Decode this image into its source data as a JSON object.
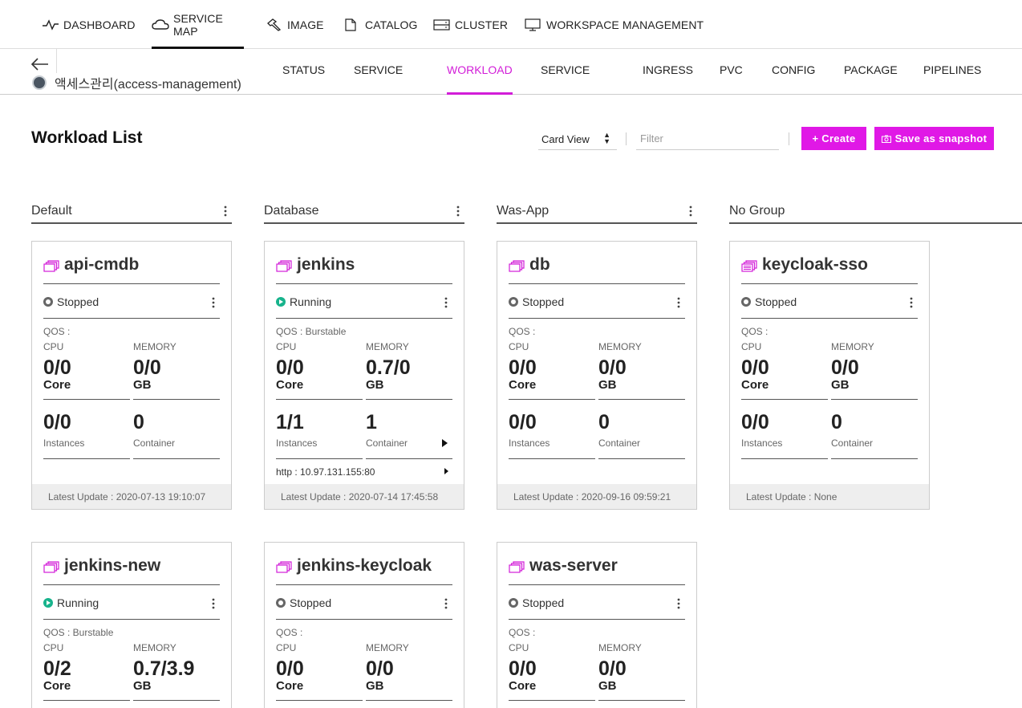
{
  "topnav": {
    "items": [
      {
        "label": "DASHBOARD",
        "icon": "pulse-icon"
      },
      {
        "label": "SERVICE MAP",
        "icon": "cloud-icon",
        "active": true
      },
      {
        "label": "IMAGE",
        "icon": "hammer-icon"
      },
      {
        "label": "CATALOG",
        "icon": "document-icon"
      },
      {
        "label": "CLUSTER",
        "icon": "server-icon"
      },
      {
        "label": "WORKSPACE MANAGEMENT",
        "icon": "monitor-icon"
      }
    ]
  },
  "subnav": {
    "workspace": "액세스관리(access-management)",
    "tabs": [
      {
        "label": "STATUS"
      },
      {
        "label": "SERVICE"
      },
      {
        "label": "WORKLOAD",
        "active": true
      },
      {
        "label": "SERVICE"
      },
      {
        "label": "INGRESS"
      },
      {
        "label": "PVC"
      },
      {
        "label": "CONFIG"
      },
      {
        "label": "PACKAGE"
      },
      {
        "label": "PIPELINES"
      }
    ]
  },
  "toolbar": {
    "title": "Workload List",
    "view": "Card View",
    "filter_placeholder": "Filter",
    "create_label": "+ Create",
    "snapshot_label": "Save as snapshot"
  },
  "groups": [
    {
      "name": "Default"
    },
    {
      "name": "Database"
    },
    {
      "name": "Was-App"
    },
    {
      "name": "No Group"
    }
  ],
  "cards": [
    {
      "name": "api-cmdb",
      "status": "Stopped",
      "qos": "QOS :",
      "cpu_label": "CPU",
      "mem_label": "MEMORY",
      "cpu": "0/0",
      "cpu_unit": "Core",
      "mem": "0/0",
      "mem_unit": "GB",
      "instances": "0/0",
      "instances_label": "Instances",
      "containers": "0",
      "containers_label": "Container",
      "url": "",
      "updated": "Latest Update : 2020-07-13 19:10:07"
    },
    {
      "name": "jenkins",
      "status": "Running",
      "qos": "QOS : Burstable",
      "cpu_label": "CPU",
      "mem_label": "MEMORY",
      "cpu": "0/0",
      "cpu_unit": "Core",
      "mem": "0.7/0",
      "mem_unit": "GB",
      "instances": "1/1",
      "instances_label": "Instances",
      "containers": "1",
      "containers_label": "Container",
      "url": "http : 10.97.131.155:80",
      "updated": "Latest Update : 2020-07-14 17:45:58"
    },
    {
      "name": "db",
      "status": "Stopped",
      "qos": "QOS :",
      "cpu_label": "CPU",
      "mem_label": "MEMORY",
      "cpu": "0/0",
      "cpu_unit": "Core",
      "mem": "0/0",
      "mem_unit": "GB",
      "instances": "0/0",
      "instances_label": "Instances",
      "containers": "0",
      "containers_label": "Container",
      "url": "",
      "updated": "Latest Update : 2020-09-16 09:59:21"
    },
    {
      "name": "keycloak-sso",
      "status": "Stopped",
      "qos": "QOS :",
      "cpu_label": "CPU",
      "mem_label": "MEMORY",
      "cpu": "0/0",
      "cpu_unit": "Core",
      "mem": "0/0",
      "mem_unit": "GB",
      "instances": "0/0",
      "instances_label": "Instances",
      "containers": "0",
      "containers_label": "Container",
      "url": "",
      "updated": "Latest Update : None"
    },
    {
      "name": "jenkins-new",
      "status": "Running",
      "qos": "QOS : Burstable",
      "cpu_label": "CPU",
      "mem_label": "MEMORY",
      "cpu": "0/2",
      "cpu_unit": "Core",
      "mem": "0.7/3.9",
      "mem_unit": "GB"
    },
    {
      "name": "jenkins-keycloak",
      "status": "Stopped",
      "qos": "QOS :",
      "cpu_label": "CPU",
      "mem_label": "MEMORY",
      "cpu": "0/0",
      "cpu_unit": "Core",
      "mem": "0/0",
      "mem_unit": "GB"
    },
    {
      "name": "was-server",
      "status": "Stopped",
      "qos": "QOS :",
      "cpu_label": "CPU",
      "mem_label": "MEMORY",
      "cpu": "0/0",
      "cpu_unit": "Core",
      "mem": "0/0",
      "mem_unit": "GB"
    }
  ],
  "colors": {
    "accent": "#e018e6",
    "running": "#17b38c",
    "stopped": "#666666"
  }
}
